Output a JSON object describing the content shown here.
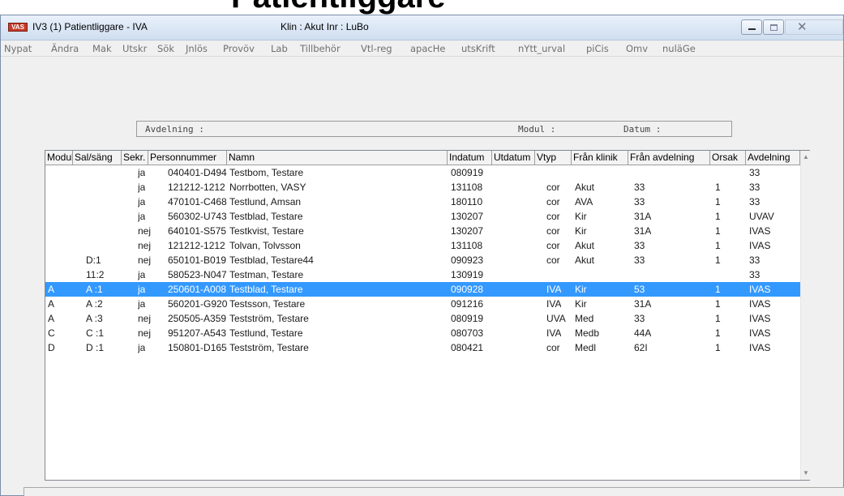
{
  "doc_header": {
    "text": "Patientliggare"
  },
  "window": {
    "icon_text": "VAS",
    "title": "IV3 (1) Patientliggare - IVA",
    "info": "Klin : Akut  Inr : LuBo",
    "close_glyph": "✕"
  },
  "menu": {
    "items": [
      "Nypat",
      "Ändra",
      "Mak",
      "Utskr",
      "Sök",
      "Jnlös",
      "Provöv",
      "Lab",
      "Tillbehör",
      "Vtl-reg",
      "apacHe",
      "utsKrift",
      "nYtt_urval",
      "piCis",
      "Omv",
      "nuläGe"
    ]
  },
  "filter": {
    "avdelning_label": "Avdelning :",
    "modul_label": "Modul :",
    "datum_label": "Datum :"
  },
  "grid": {
    "columns": [
      "Modul",
      "Sal/säng",
      "Sekr.",
      "Personnummer",
      "Namn",
      "Indatum",
      "Utdatum",
      "Vtyp",
      "Från klinik",
      "Från avdelning",
      "Orsak",
      "Avdelning"
    ],
    "selected_row": 8,
    "rows": [
      [
        "",
        "",
        "ja",
        "040401-D494",
        "Testbom, Testare",
        "080919",
        "",
        "",
        "",
        "",
        "",
        "33"
      ],
      [
        "",
        "",
        "ja",
        "121212-1212",
        "Norrbotten, VASY",
        "131108",
        "",
        "cor",
        "Akut",
        "33",
        "1",
        "33"
      ],
      [
        "",
        "",
        "ja",
        "470101-C468",
        "Testlund, Amsan",
        "180110",
        "",
        "cor",
        "AVA",
        "33",
        "1",
        "33"
      ],
      [
        "",
        "",
        "ja",
        "560302-U743",
        "Testblad, Testare",
        "130207",
        "",
        "cor",
        "Kir",
        "31A",
        "1",
        "UVAV"
      ],
      [
        "",
        "",
        "nej",
        "640101-S575",
        "Testkvist, Testare",
        "130207",
        "",
        "cor",
        "Kir",
        "31A",
        "1",
        "IVAS"
      ],
      [
        "",
        "",
        "nej",
        "121212-1212",
        "Tolvan, Tolvsson",
        "131108",
        "",
        "cor",
        "Akut",
        "33",
        "1",
        "IVAS"
      ],
      [
        "",
        "D:1",
        "nej",
        "650101-B019",
        "Testblad, Testare44",
        "090923",
        "",
        "cor",
        "Akut",
        "33",
        "1",
        "33"
      ],
      [
        "",
        "11:2",
        "ja",
        "580523-N047",
        "Testman, Testare",
        "130919",
        "",
        "",
        "",
        "",
        "",
        "33"
      ],
      [
        "A",
        "A :1",
        "ja",
        "250601-A008",
        "Testblad, Testare",
        "090928",
        "",
        "IVA",
        "Kir",
        "53",
        "1",
        "IVAS"
      ],
      [
        "A",
        "A :2",
        "ja",
        "560201-G920",
        "Testsson, Testare",
        "091216",
        "",
        "IVA",
        "Kir",
        "31A",
        "1",
        "IVAS"
      ],
      [
        "A",
        "A :3",
        "nej",
        "250505-A359",
        "Testström, Testare",
        "080919",
        "",
        "UVA",
        "Med",
        "33",
        "1",
        "IVAS"
      ],
      [
        "C",
        "C :1",
        "nej",
        "951207-A543",
        "Testlund, Testare",
        "080703",
        "",
        "IVA",
        "Medb",
        "44A",
        "1",
        "IVAS"
      ],
      [
        "D",
        "D :1",
        "ja",
        "150801-D165",
        "Testström, Testare",
        "080421",
        "",
        "cor",
        "Medl",
        "62I",
        "1",
        "IVAS"
      ]
    ]
  },
  "scrollbar": {
    "up_glyph": "▲",
    "down_glyph": "▼"
  },
  "colors": {
    "selection": "#3399ff",
    "window_bg": "#f0f0f0",
    "titlebar": "#dbe7f5",
    "app_icon": "#c53a2a"
  }
}
